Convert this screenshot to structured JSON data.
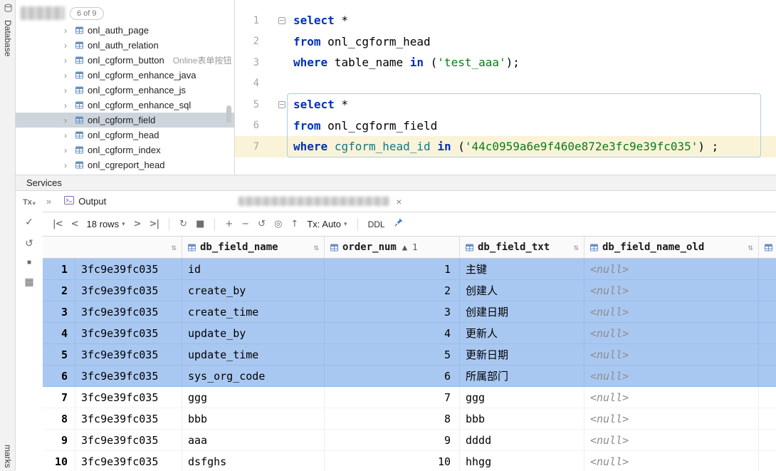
{
  "accent_colors": {
    "grid_selection_blue": "#a9c8f1",
    "tree_selection_gray": "#cdd5dc",
    "caret_line_yellow": "#faf3d8",
    "statement_box_blue": "#aecbe8",
    "table_icon_blue": "#6b8fc4"
  },
  "stripe": {
    "database_label": "Database",
    "bookmarks_label": "marks"
  },
  "tree": {
    "search_count": "6 of 9",
    "chevron": "›",
    "items": [
      {
        "label": "onl_auth_page"
      },
      {
        "label": "onl_auth_relation"
      },
      {
        "label": "onl_cgform_button",
        "comment": "Online表单按钮"
      },
      {
        "label": "onl_cgform_enhance_java"
      },
      {
        "label": "onl_cgform_enhance_js"
      },
      {
        "label": "onl_cgform_enhance_sql"
      },
      {
        "label": "onl_cgform_field",
        "selected": true
      },
      {
        "label": "onl_cgform_head"
      },
      {
        "label": "onl_cgform_index"
      },
      {
        "label": "onl_cgreport_head"
      }
    ]
  },
  "editor": {
    "colors": {
      "kw": "#0032b4",
      "str": "#067d17",
      "col": "#0e7a86",
      "pl": "#000000"
    },
    "lines": [
      {
        "num": "1",
        "fold": true,
        "tokens": [
          [
            "select",
            "kw"
          ],
          [
            " *",
            "pl"
          ]
        ]
      },
      {
        "num": "2",
        "tokens": [
          [
            "from",
            "kw"
          ],
          [
            " onl_cgform_head",
            "pl"
          ]
        ]
      },
      {
        "num": "3",
        "tokens": [
          [
            "where",
            "kw"
          ],
          [
            " table_name ",
            "pl"
          ],
          [
            "in",
            "kw"
          ],
          [
            " (",
            "pl"
          ],
          [
            "'test_aaa'",
            "str"
          ],
          [
            ");",
            "pl"
          ]
        ]
      },
      {
        "num": "4",
        "tokens": []
      },
      {
        "num": "5",
        "fold": true,
        "tokens": [
          [
            "select",
            "kw"
          ],
          [
            " *",
            "pl"
          ]
        ]
      },
      {
        "num": "6",
        "tokens": [
          [
            "from",
            "kw"
          ],
          [
            " onl_cgform_field",
            "pl"
          ]
        ]
      },
      {
        "num": "7",
        "caret": true,
        "tokens": [
          [
            "where",
            "kw"
          ],
          [
            " ",
            "pl"
          ],
          [
            "cgform_head_id",
            "col"
          ],
          [
            " ",
            "pl"
          ],
          [
            "in",
            "kw"
          ],
          [
            " (",
            "pl"
          ],
          [
            "'44c0959a6e9f460e872e3fc9e39fc035'",
            "str"
          ],
          [
            ") ;",
            "pl"
          ]
        ]
      }
    ]
  },
  "services": {
    "panel_title": "Services",
    "side_icons": {
      "tx": "Tx",
      "dropdown": "▾",
      "commit": "✓",
      "rollback": "↺",
      "stop": "■",
      "layout": "▦"
    },
    "tabs": {
      "chevrons": "»",
      "output_label": "Output",
      "close": "×"
    },
    "toolbar": {
      "rows_label": "18 rows",
      "tx_label": "Tx: Auto",
      "ddl_label": "DDL",
      "icons": {
        "first": "|<",
        "prev": "<",
        "next": ">",
        "last": ">|",
        "dropdown": "▾",
        "reload": "↻",
        "stop": "■",
        "add": "+",
        "remove": "−",
        "revert": "↺",
        "compare": "◎",
        "submit": "↑"
      }
    }
  },
  "grid": {
    "columns": [
      {
        "label": "",
        "sort": "⇅"
      },
      {
        "label": "db_field_name",
        "icon": true,
        "sort": "⇅"
      },
      {
        "label": "order_num",
        "icon": true,
        "sort": "▲ 1",
        "sort_inline": true
      },
      {
        "label": "db_field_txt",
        "icon": true,
        "sort": "⇅"
      },
      {
        "label": "db_field_name_old",
        "icon": true,
        "sort": "⇅"
      },
      {
        "label": "",
        "icon": true,
        "filler": true
      }
    ],
    "rows": [
      {
        "n": "1",
        "id": "3fc9e39fc035",
        "field": "id",
        "order": "1",
        "txt": "主键",
        "old": "<null>",
        "selected": true
      },
      {
        "n": "2",
        "id": "3fc9e39fc035",
        "field": "create_by",
        "order": "2",
        "txt": "创建人",
        "old": "<null>",
        "selected": true
      },
      {
        "n": "3",
        "id": "3fc9e39fc035",
        "field": "create_time",
        "order": "3",
        "txt": "创建日期",
        "old": "<null>",
        "selected": true
      },
      {
        "n": "4",
        "id": "3fc9e39fc035",
        "field": "update_by",
        "order": "4",
        "txt": "更新人",
        "old": "<null>",
        "selected": true
      },
      {
        "n": "5",
        "id": "3fc9e39fc035",
        "field": "update_time",
        "order": "5",
        "txt": "更新日期",
        "old": "<null>",
        "selected": true
      },
      {
        "n": "6",
        "id": "3fc9e39fc035",
        "field": "sys_org_code",
        "order": "6",
        "txt": "所属部门",
        "old": "<null>",
        "selected": true
      },
      {
        "n": "7",
        "id": "3fc9e39fc035",
        "field": "ggg",
        "order": "7",
        "txt": "ggg",
        "old": "<null>",
        "selected": false
      },
      {
        "n": "8",
        "id": "3fc9e39fc035",
        "field": "bbb",
        "order": "8",
        "txt": "bbb",
        "old": "<null>",
        "selected": false
      },
      {
        "n": "9",
        "id": "3fc9e39fc035",
        "field": "aaa",
        "order": "9",
        "txt": "dddd",
        "old": "<null>",
        "selected": false
      },
      {
        "n": "10",
        "id": "3fc9e39fc035",
        "field": "dsfghs",
        "order": "10",
        "txt": "hhgg",
        "old": "<null>",
        "selected": false
      }
    ]
  }
}
